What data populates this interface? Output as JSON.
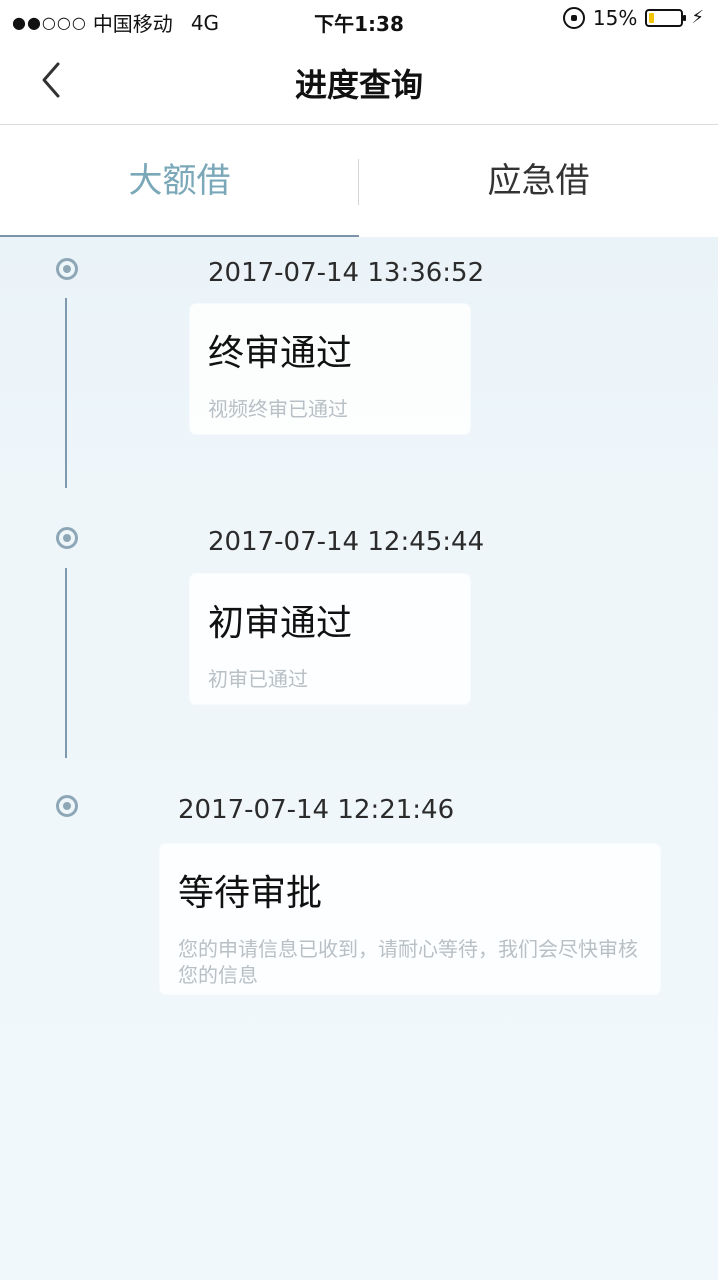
{
  "status_bar": {
    "signal": "●●○○○",
    "carrier": "中国移动",
    "network": "4G",
    "time": "下午1:38",
    "battery": "15%"
  },
  "nav": {
    "title": "进度查询"
  },
  "tabs": [
    {
      "label": "大额借",
      "active": true
    },
    {
      "label": "应急借",
      "active": false
    }
  ],
  "timeline": [
    {
      "time": "2017-07-14 13:36:52",
      "title": "终审通过",
      "desc": "视频终审已通过"
    },
    {
      "time": "2017-07-14 12:45:44",
      "title": "初审通过",
      "desc": "初审已通过"
    },
    {
      "time": "2017-07-14 12:21:46",
      "title": "等待审批",
      "desc": "您的申请信息已收到，请耐心等待，我们会尽快审核您的信息"
    }
  ],
  "colors": {
    "accent_tab": "#7aa8b8",
    "timeline": "#7f9aaf",
    "background": "#eef6fa"
  }
}
